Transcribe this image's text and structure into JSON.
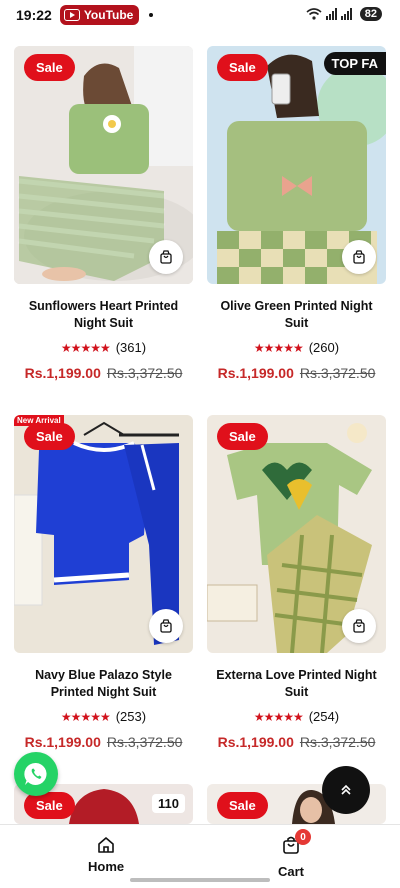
{
  "status_bar": {
    "time": "19:22",
    "app_pill": "YouTube",
    "battery": "82"
  },
  "products": [
    {
      "name": "Sunflowers Heart Printed Night Suit",
      "sale": "Sale",
      "stars": "★★★★★",
      "reviews": "(361)",
      "price": "Rs.1,199.00",
      "old_price": "Rs.3,372.50",
      "badge": ""
    },
    {
      "name": "Olive Green Printed Night Suit",
      "sale": "Sale",
      "stars": "★★★★★",
      "reviews": "(260)",
      "price": "Rs.1,199.00",
      "old_price": "Rs.3,372.50",
      "badge": "TOP FA"
    },
    {
      "name": "Navy Blue Palazo Style Printed Night Suit",
      "sale": "Sale",
      "stars": "★★★★★",
      "reviews": "(253)",
      "price": "Rs.1,199.00",
      "old_price": "Rs.3,372.50",
      "badge": "New Arrival"
    },
    {
      "name": "Externa Love Printed Night Suit",
      "sale": "Sale",
      "stars": "★★★★★",
      "reviews": "(254)",
      "price": "Rs.1,199.00",
      "old_price": "Rs.3,372.50",
      "badge": ""
    },
    {
      "sale": "Sale",
      "badge": "110"
    },
    {
      "sale": "Sale"
    }
  ],
  "bottom_nav": {
    "home": "Home",
    "cart": "Cart",
    "cart_count": "0"
  },
  "colors": {
    "sale_red": "#e0101b",
    "price_red": "#c62828",
    "whatsapp": "#25d366"
  }
}
